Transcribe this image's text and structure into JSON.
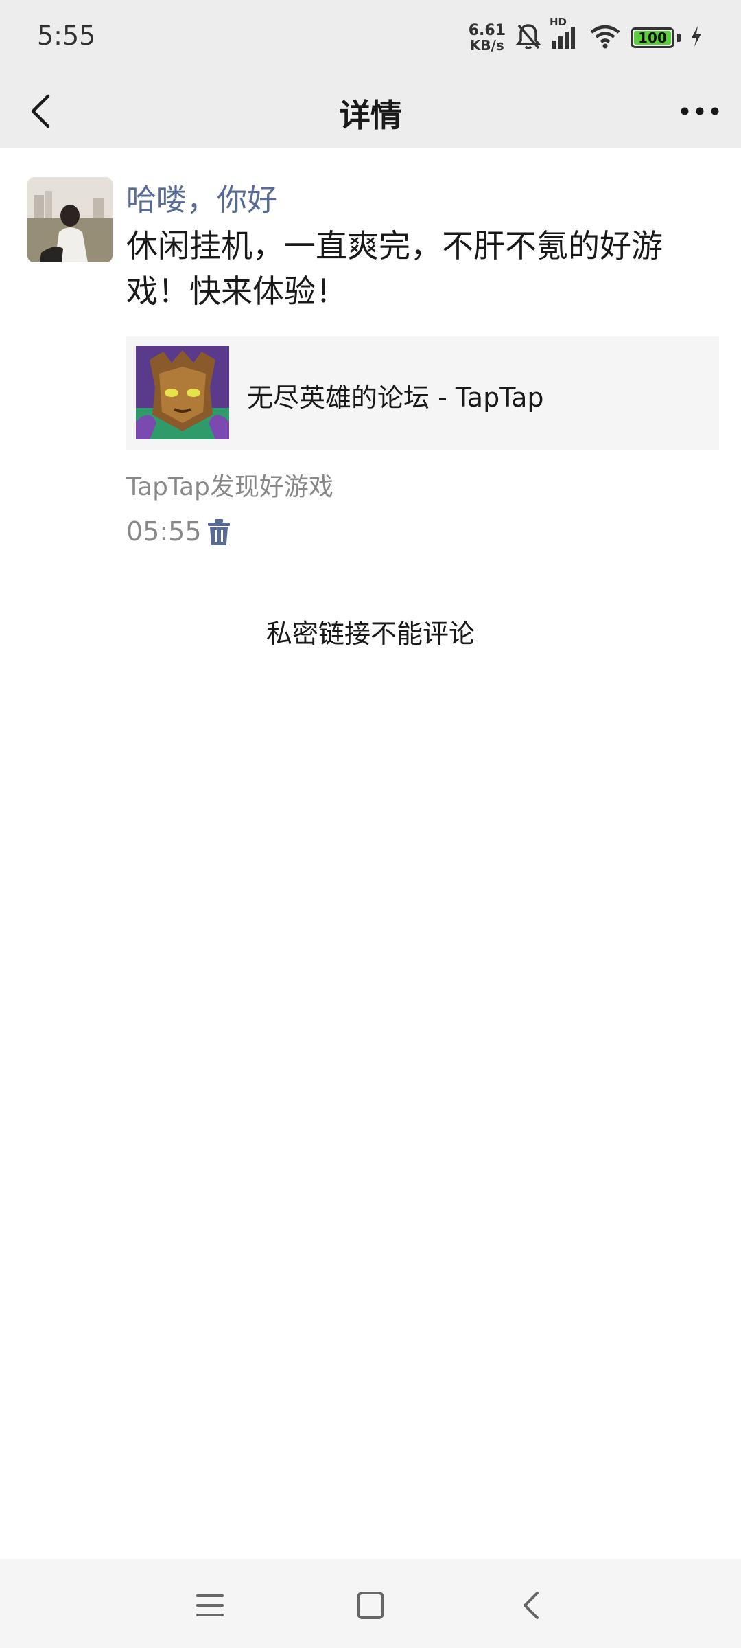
{
  "status_bar": {
    "time": "5:55",
    "net_speed_value": "6.61",
    "net_speed_unit": "KB/s",
    "signal_label": "HD",
    "battery_level": "100",
    "icons": [
      "mute-bell-icon",
      "signal-icon",
      "wifi-icon",
      "battery-icon",
      "charging-icon"
    ]
  },
  "header": {
    "title": "详情",
    "back_icon": "chevron-left-icon",
    "more_icon": "more-dots-icon"
  },
  "post": {
    "user_name": "哈喽，你好",
    "text": "休闲挂机，一直爽完，不肝不氪的好游戏！快来体验！",
    "link_card": {
      "title": "无尽英雄的论坛 - TapTap"
    },
    "source": "TapTap发现好游戏",
    "time": "05:55",
    "delete_icon": "trash-icon"
  },
  "comment_note": "私密链接不能评论",
  "system_nav": [
    "menu-icon",
    "home-square-icon",
    "back-triangle-icon"
  ],
  "colors": {
    "header_bg": "#ededed",
    "name_link": "#576b95",
    "meta_gray": "#888888",
    "card_bg": "#f5f5f5"
  }
}
